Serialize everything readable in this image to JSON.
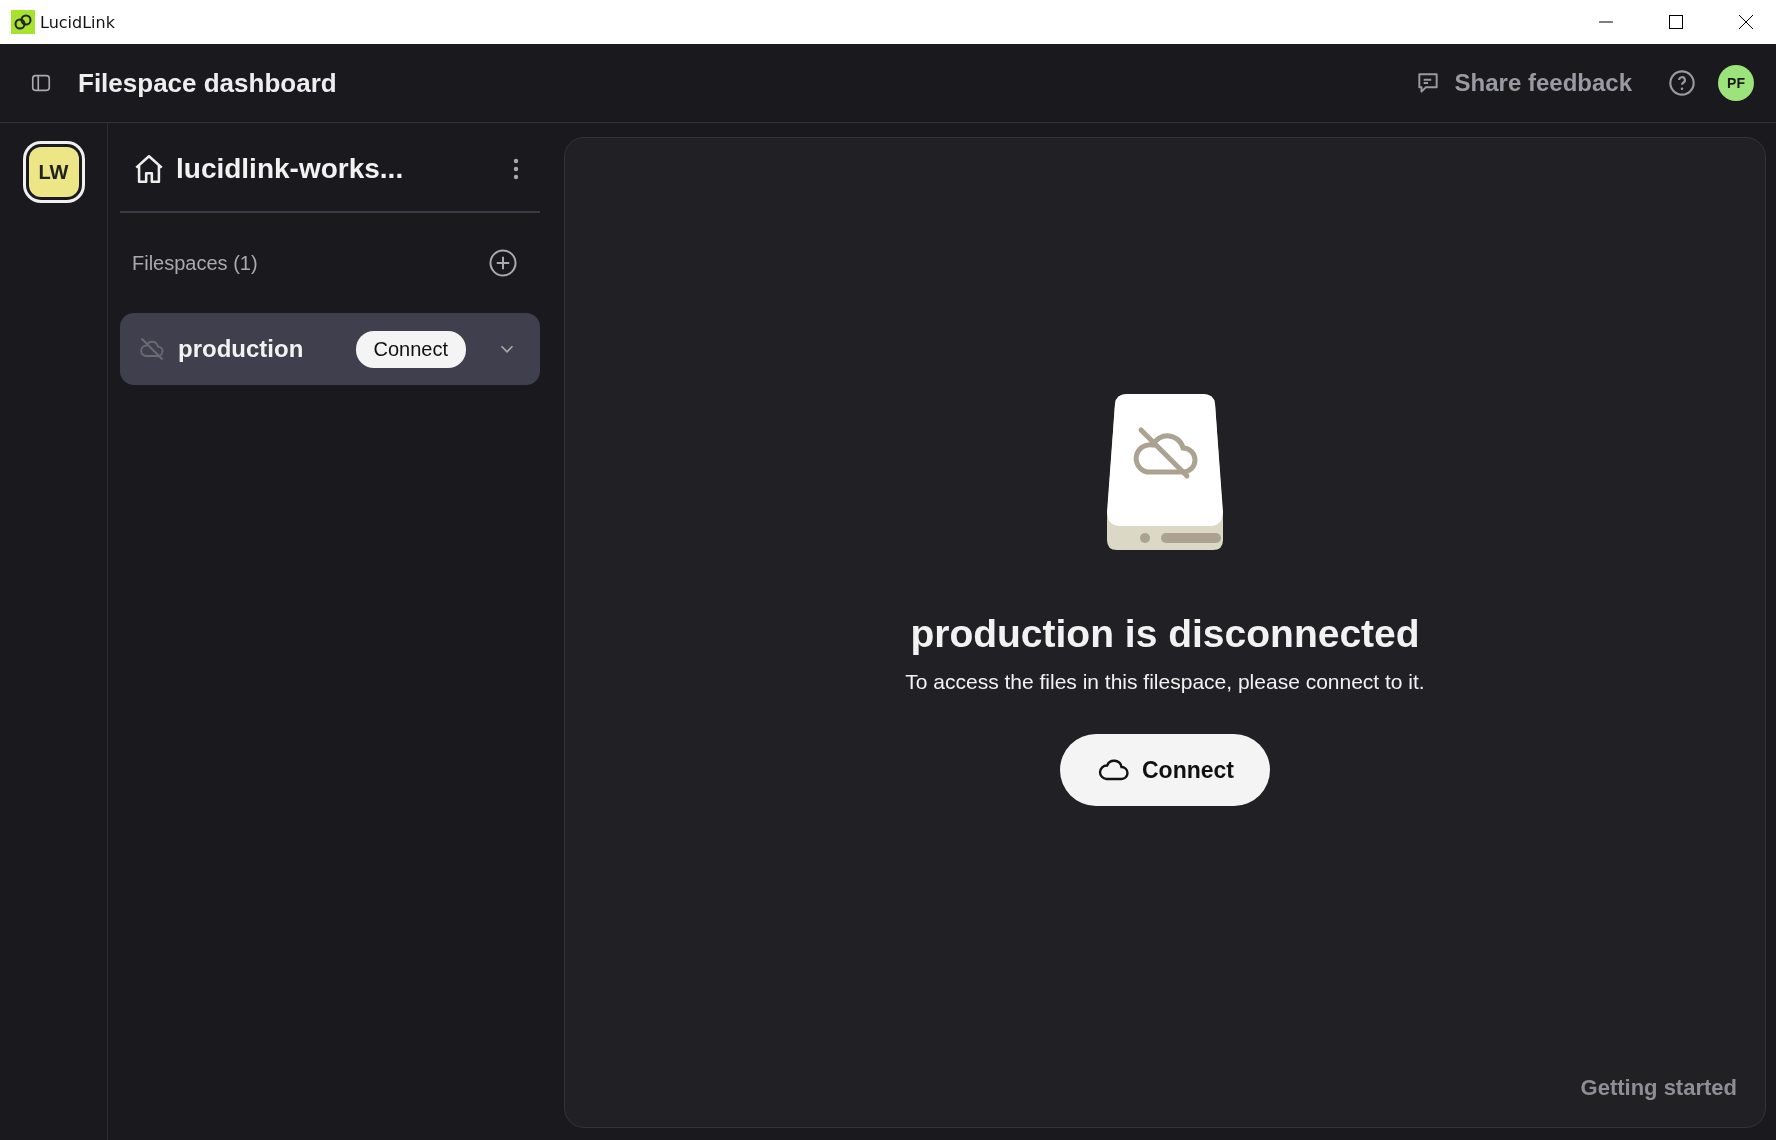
{
  "window": {
    "title": "LucidLink"
  },
  "header": {
    "title": "Filespace dashboard",
    "feedback": "Share feedback",
    "user_initials": "PF"
  },
  "rail": {
    "workspaces": [
      {
        "initials": "LW",
        "selected": true
      }
    ]
  },
  "sidebar": {
    "workspace_name": "lucidlink-works...",
    "section_label": "Filespaces (1)",
    "filespaces": [
      {
        "name": "production",
        "connected": false,
        "selected": true,
        "action": "Connect"
      }
    ]
  },
  "main": {
    "connected": false,
    "heading": "production is disconnected",
    "message": "To access the files in this filespace, please connect to it.",
    "button": "Connect",
    "footer_link": "Getting started"
  }
}
